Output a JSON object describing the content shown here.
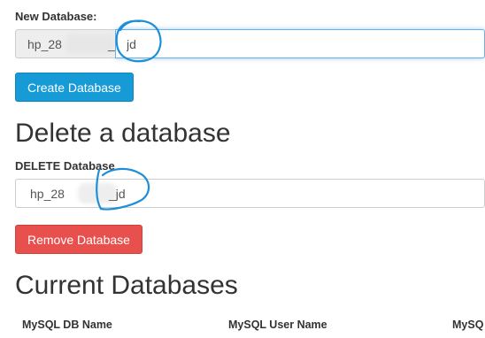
{
  "create": {
    "label": "New Database:",
    "prefix_start": "hp_28",
    "prefix_end": "_",
    "value": "jd",
    "button": "Create Database"
  },
  "delete": {
    "heading": "Delete a database",
    "label": "DELETE Database",
    "value_start": "hp_28",
    "value_end": "_jd",
    "button": "Remove Database"
  },
  "current": {
    "heading": "Current Databases",
    "columns": [
      "MySQL DB Name",
      "MySQL User Name",
      "MySQ"
    ]
  },
  "colors": {
    "primary": "#179bd7",
    "danger": "#e8504e",
    "annotation": "#1e8fd6"
  }
}
